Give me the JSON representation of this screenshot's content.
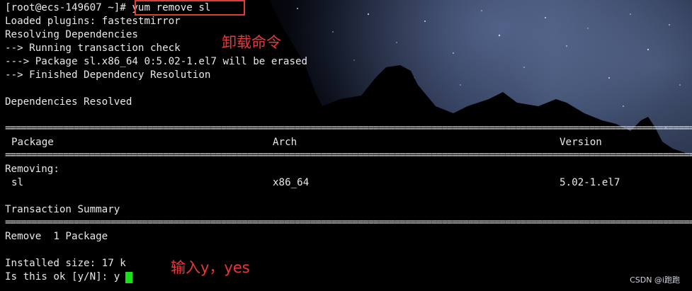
{
  "prompt": "[root@ecs-149607 ~]#",
  "command": "yum remove sl",
  "lines": {
    "l1": "Loaded plugins: fastestmirror",
    "l2": "Resolving Dependencies",
    "l3": "--> Running transaction check",
    "l4": "---> Package sl.x86_64 0:5.02-1.el7 will be erased",
    "l5": "--> Finished Dependency Resolution",
    "l6": "Dependencies Resolved",
    "removing": "Removing:",
    "summary": "Transaction Summary",
    "remove": "Remove  1 Package",
    "installed_size": "Installed size: 17 k",
    "is_ok": "Is this ok [y/N]: y"
  },
  "table": {
    "headers": [
      "Package",
      "Arch",
      "Version"
    ],
    "row": [
      "sl",
      "x86_64",
      "5.02-1.el7"
    ]
  },
  "separator": "==========================================================================================================================================",
  "annotations": {
    "uninstall": "卸载命令",
    "input_yes": "输入y，yes"
  },
  "watermark": "CSDN @i跑跑",
  "colors": {
    "text": "#e8e8e8",
    "highlight_box": "#e03c3c",
    "annotation": "#e8383c",
    "cursor": "#19e21a"
  }
}
